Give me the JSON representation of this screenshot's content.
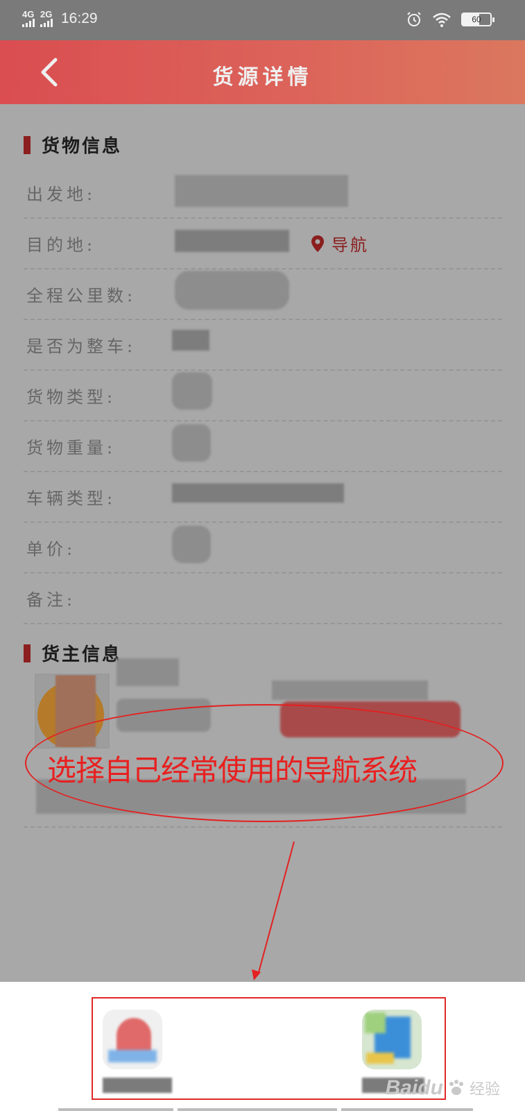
{
  "status_bar": {
    "network1": "4G",
    "network2": "2G",
    "time": "16:29",
    "battery": "60"
  },
  "header": {
    "title": "货源详情",
    "back_icon": "chevron-left-icon"
  },
  "cargo_section": {
    "title": "货物信息",
    "rows": [
      {
        "label": "出发地:"
      },
      {
        "label": "目的地:",
        "nav_label": "导航"
      },
      {
        "label": "全程公里数:"
      },
      {
        "label": "是否为整车:"
      },
      {
        "label": "货物类型:"
      },
      {
        "label": "货物重量:"
      },
      {
        "label": "车辆类型:"
      },
      {
        "label": "单价:"
      },
      {
        "label": "备注:"
      }
    ]
  },
  "owner_section": {
    "title": "货主信息"
  },
  "annotation": {
    "text": "选择自己经常使用的导航系统",
    "color": "#e81f1f"
  },
  "watermark": {
    "brand": "Baidu",
    "sub": "经验"
  },
  "colors": {
    "accent": "#e8574a",
    "section_bar": "#8c1f1f",
    "nav": "#8b1e1e"
  }
}
